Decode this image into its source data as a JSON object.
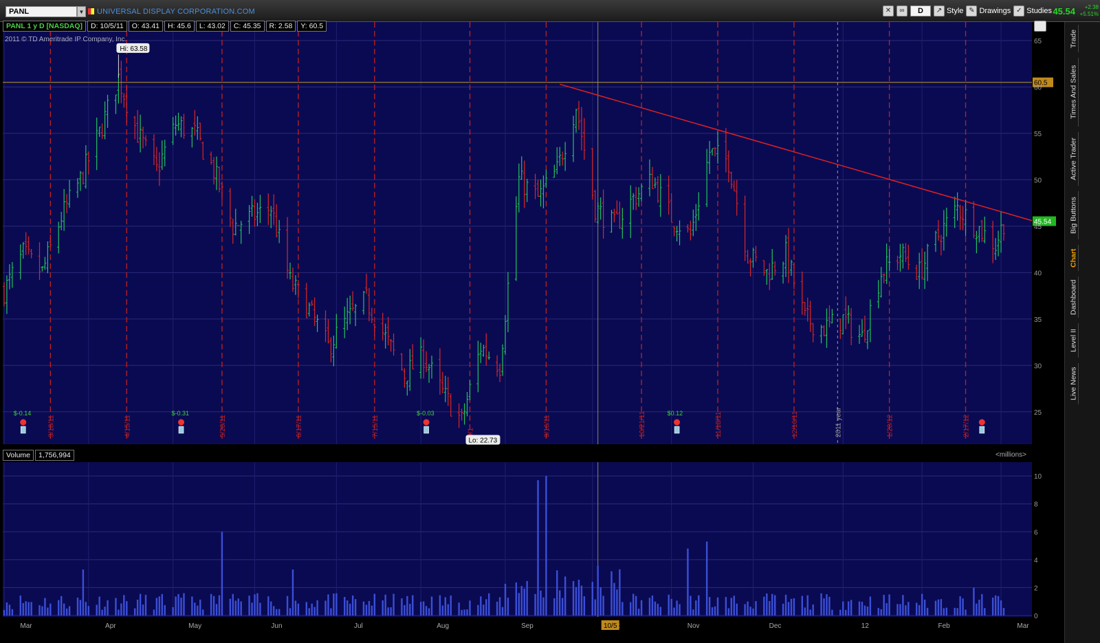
{
  "topbar": {
    "symbol": "PANL",
    "company": "UNIVERSAL DISPLAY CORPORATION.COM",
    "aggregation": "D",
    "style_label": "Style",
    "drawings_label": "Drawings",
    "studies_label": "Studies",
    "last_price": "45.54",
    "net_change": "+2.38",
    "pct_change": "+5.51%"
  },
  "header": {
    "title": "PANL 1 y D [NASDAQ]",
    "date": "D: 10/5/11",
    "open": "O: 43.41",
    "high": "H: 45.6",
    "low": "L: 43.02",
    "close": "C: 45.35",
    "range": "R: 2.58",
    "y": "Y: 60.5",
    "copyright": "2011 © TD Ameritrade IP Company, Inc."
  },
  "volume_header": {
    "label": "Volume",
    "value": "1,756,994",
    "units": "<millions>"
  },
  "side_tabs": [
    "Trade",
    "Times And Sales",
    "Active Trader",
    "Big Buttons",
    "Chart",
    "Dashboard",
    "Level II",
    "Live News"
  ],
  "active_tab": "Chart",
  "colors": {
    "background": "#0a0a52",
    "up_bar": "#22c55e",
    "down_bar": "#dc2626",
    "volume_bar": "#3b4fd6",
    "trendline": "#e02020",
    "hline": "#b89a2a",
    "separator": "#c02020"
  },
  "chart_data": {
    "type": "ohlc",
    "title": "PANL 1 y D [NASDAQ]",
    "price_axis": {
      "ticks": [
        25,
        30,
        35,
        40,
        45,
        50,
        55,
        60,
        65
      ],
      "range": [
        21.5,
        67
      ]
    },
    "volume_axis": {
      "ticks": [
        0,
        2,
        4,
        6,
        8,
        10
      ],
      "range": [
        0,
        10.6
      ],
      "unit": "millions"
    },
    "months": [
      "Mar",
      "Apr",
      "May",
      "Jun",
      "Jul",
      "Aug",
      "Sep",
      "Oct",
      "Nov",
      "Dec",
      "12",
      "Feb",
      "Mar"
    ],
    "current_date_marker": "10/5",
    "year_marker": "2011 year",
    "annotations": {
      "high": "Hi: 63.58",
      "low": "Lo: 22.73",
      "hline_value": "60.5",
      "price_marker": "45.54"
    },
    "expiration_dates": [
      "3/18/11",
      "4/15/11",
      "5/20/11",
      "6/17/11",
      "7/15/11",
      "9/1",
      "9/16/11",
      "10/21/11",
      "11/18/11",
      "12/16/11",
      "1/20/12",
      "2/17/12"
    ],
    "earnings": [
      "$-0.14",
      "$-0.31",
      "$-0.03",
      "$0.12",
      ""
    ],
    "close_path": [
      [
        "2011-03-01",
        38
      ],
      [
        "2011-03-08",
        42
      ],
      [
        "2011-03-15",
        40
      ],
      [
        "2011-03-22",
        46
      ],
      [
        "2011-03-29",
        50
      ],
      [
        "2011-04-05",
        55
      ],
      [
        "2011-04-12",
        61
      ],
      [
        "2011-04-19",
        55
      ],
      [
        "2011-04-26",
        51
      ],
      [
        "2011-05-03",
        56
      ],
      [
        "2011-05-10",
        55
      ],
      [
        "2011-05-17",
        51
      ],
      [
        "2011-05-24",
        45
      ],
      [
        "2011-05-31",
        46
      ],
      [
        "2011-06-07",
        47
      ],
      [
        "2011-06-14",
        39
      ],
      [
        "2011-06-21",
        36
      ],
      [
        "2011-06-28",
        32
      ],
      [
        "2011-07-05",
        35
      ],
      [
        "2011-07-12",
        37
      ],
      [
        "2011-07-19",
        33
      ],
      [
        "2011-07-26",
        29
      ],
      [
        "2011-08-02",
        31
      ],
      [
        "2011-08-09",
        27
      ],
      [
        "2011-08-16",
        24
      ],
      [
        "2011-08-23",
        32
      ],
      [
        "2011-08-30",
        30
      ],
      [
        "2011-09-06",
        50
      ],
      [
        "2011-09-13",
        48
      ],
      [
        "2011-09-20",
        51
      ],
      [
        "2011-09-27",
        58
      ],
      [
        "2011-10-04",
        47
      ],
      [
        "2011-10-11",
        45
      ],
      [
        "2011-10-18",
        48
      ],
      [
        "2011-10-25",
        50
      ],
      [
        "2011-11-01",
        46
      ],
      [
        "2011-11-08",
        44
      ],
      [
        "2011-11-15",
        53
      ],
      [
        "2011-11-22",
        52
      ],
      [
        "2011-11-29",
        42
      ],
      [
        "2011-12-06",
        40
      ],
      [
        "2011-12-13",
        42
      ],
      [
        "2011-12-20",
        35
      ],
      [
        "2011-12-27",
        34
      ],
      [
        "2012-01-03",
        35
      ],
      [
        "2012-01-10",
        33
      ],
      [
        "2012-01-17",
        40
      ],
      [
        "2012-01-24",
        42
      ],
      [
        "2012-01-31",
        40
      ],
      [
        "2012-02-07",
        44
      ],
      [
        "2012-02-14",
        47
      ],
      [
        "2012-02-21",
        45
      ],
      [
        "2012-02-28",
        43
      ],
      [
        "2012-03-02",
        45.5
      ]
    ],
    "volume_peaks": [
      [
        "2011-03-30",
        3.3
      ],
      [
        "2011-04-10",
        3.5
      ],
      [
        "2011-05-20",
        6.0
      ],
      [
        "2011-06-15",
        3.3
      ],
      [
        "2011-08-28",
        3.5
      ],
      [
        "2011-09-13",
        9.7
      ],
      [
        "2011-09-16",
        10.0
      ],
      [
        "2011-09-24",
        5.1
      ],
      [
        "2011-10-01",
        3.9
      ],
      [
        "2011-11-07",
        4.8
      ],
      [
        "2011-11-14",
        5.3
      ],
      [
        "2012-01-01",
        4.9
      ],
      [
        "2012-02-20",
        2.0
      ]
    ]
  }
}
